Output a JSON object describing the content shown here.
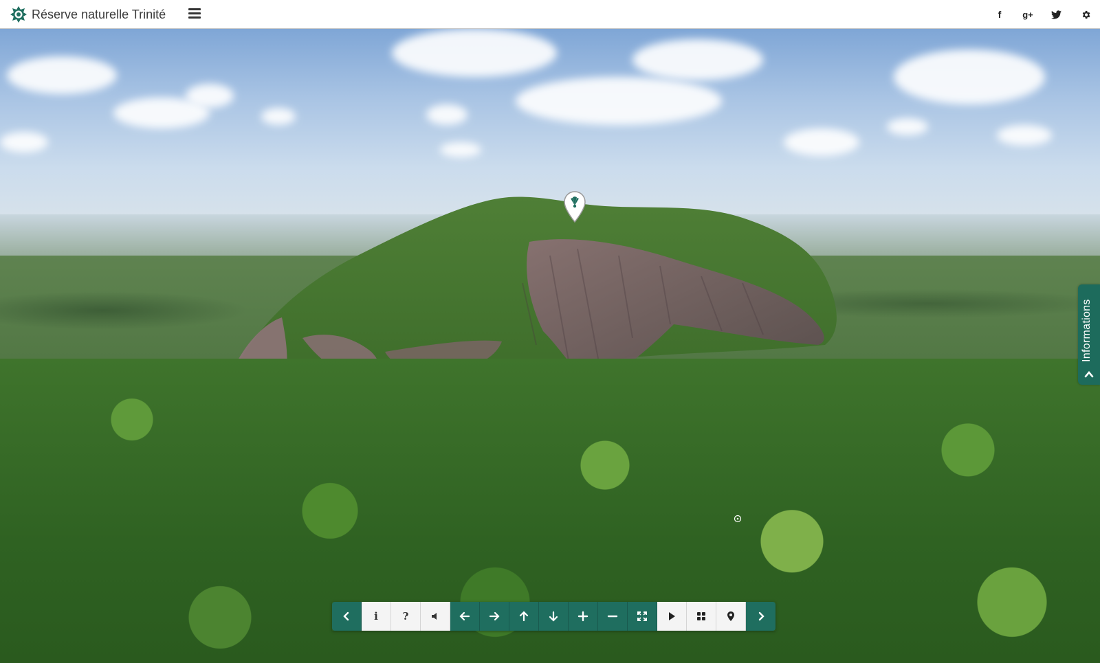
{
  "header": {
    "title": "Réserve naturelle Trinité",
    "menu_icon": "hamburger-menu-icon",
    "social": [
      {
        "name": "facebook",
        "glyph": "f"
      },
      {
        "name": "google-plus",
        "glyph": "g+"
      },
      {
        "name": "twitter",
        "glyph": "twitter"
      },
      {
        "name": "settings",
        "glyph": "gear"
      }
    ]
  },
  "side_panel": {
    "label": "Informations",
    "icon": "chevron-up-icon"
  },
  "hotspot": {
    "icon": "map-pin-palm-icon"
  },
  "toolbar": {
    "buttons": [
      {
        "name": "previous",
        "icon": "chevron-left-icon",
        "style": "dark"
      },
      {
        "name": "info",
        "icon": "info-icon",
        "glyph": "i",
        "style": "light"
      },
      {
        "name": "help",
        "icon": "question-icon",
        "glyph": "?",
        "style": "light"
      },
      {
        "name": "sound",
        "icon": "speaker-mute-icon",
        "style": "light"
      },
      {
        "name": "pan-left",
        "icon": "arrow-left-icon",
        "style": "dark"
      },
      {
        "name": "pan-right",
        "icon": "arrow-right-icon",
        "style": "dark"
      },
      {
        "name": "pan-up",
        "icon": "arrow-up-icon",
        "style": "dark"
      },
      {
        "name": "pan-down",
        "icon": "arrow-down-icon",
        "style": "dark"
      },
      {
        "name": "zoom-in",
        "icon": "plus-icon",
        "style": "dark"
      },
      {
        "name": "zoom-out",
        "icon": "minus-icon",
        "style": "dark"
      },
      {
        "name": "fullscreen",
        "icon": "fullscreen-icon",
        "style": "dark"
      },
      {
        "name": "autoplay",
        "icon": "play-icon",
        "style": "light"
      },
      {
        "name": "thumbnails",
        "icon": "grid-icon",
        "style": "light"
      },
      {
        "name": "map",
        "icon": "map-marker-icon",
        "style": "light"
      },
      {
        "name": "next",
        "icon": "chevron-right-icon",
        "style": "dark"
      }
    ]
  },
  "colors": {
    "accent": "#1f6e5f",
    "header_bg": "#ffffff",
    "toolbar_light": "#f4f4f4"
  }
}
